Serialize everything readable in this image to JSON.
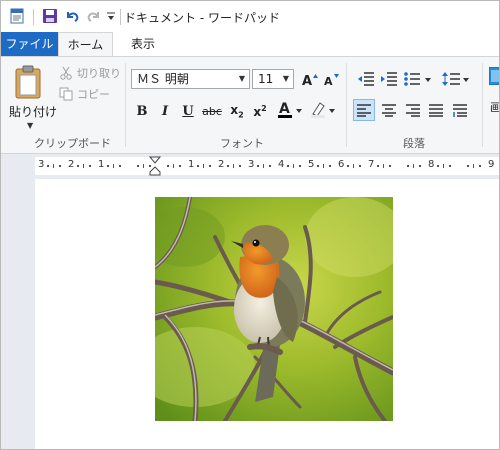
{
  "window": {
    "title": "ドキュメント - ワードパッド"
  },
  "tabs": {
    "file": "ファイル",
    "home": "ホーム",
    "view": "表示"
  },
  "clipboard": {
    "paste": "貼り付け",
    "cut": "切り取り",
    "copy": "コピー",
    "label": "クリップボード"
  },
  "font": {
    "name": "ＭＳ 明朝",
    "size": "11",
    "label": "フォント"
  },
  "paragraph": {
    "label": "段落"
  },
  "ruler": {
    "labels": [
      "3",
      "2",
      "1",
      "1",
      "2",
      "3",
      "4",
      "5",
      "6",
      "7",
      "8",
      "9"
    ]
  },
  "document": {
    "image": "robin-bird-on-branch"
  },
  "colors": {
    "accent": "#1e6bc6",
    "ribbon_bg": "#f5f6f7",
    "doc_bg": "#e7ebf1"
  }
}
